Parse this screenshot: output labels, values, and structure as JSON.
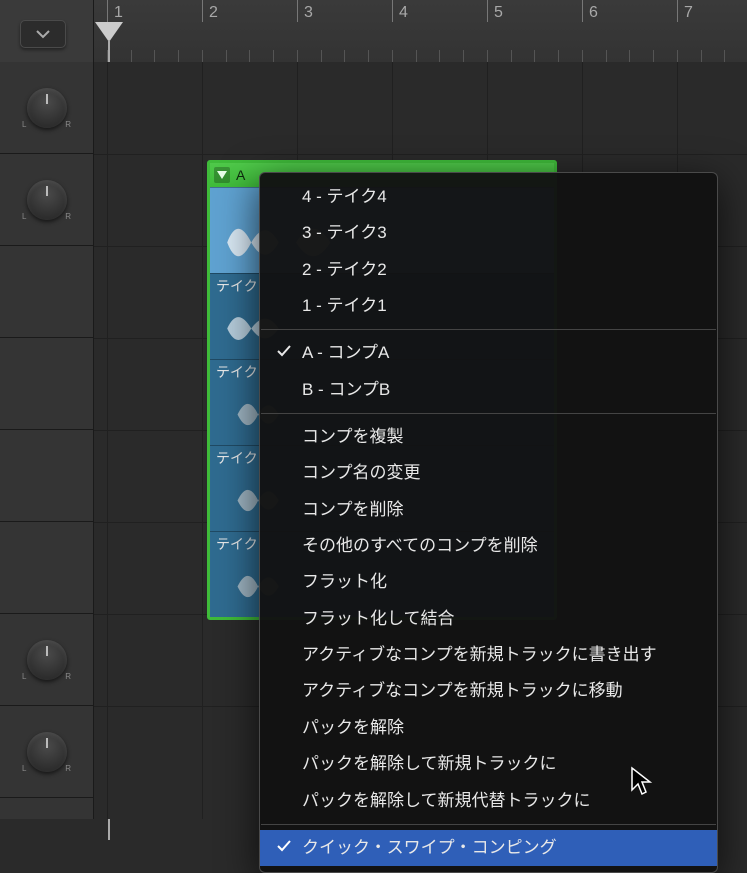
{
  "ruler": {
    "labels": [
      "1",
      "2",
      "3",
      "4",
      "5",
      "6",
      "7"
    ]
  },
  "lr": {
    "l": "L",
    "r": "R"
  },
  "take_folder": {
    "header_label": "A",
    "lanes": [
      {
        "label": "",
        "selected": true
      },
      {
        "label": "テイク"
      },
      {
        "label": "テイク"
      },
      {
        "label": "テイク"
      },
      {
        "label": "テイク"
      }
    ]
  },
  "menu": {
    "takes": [
      {
        "label": "4 - テイク4"
      },
      {
        "label": "3 - テイク3"
      },
      {
        "label": "2 - テイク2"
      },
      {
        "label": "1 - テイク1"
      }
    ],
    "comps": [
      {
        "label": "A - コンプA",
        "checked": true
      },
      {
        "label": "B - コンプB",
        "checked": false
      }
    ],
    "actions": [
      "コンプを複製",
      "コンプ名の変更",
      "コンプを削除",
      "その他のすべてのコンプを削除",
      "フラット化",
      "フラット化して結合",
      "アクティブなコンプを新規トラックに書き出す",
      "アクティブなコンプを新規トラックに移動",
      "パックを解除",
      "パックを解除して新規トラックに",
      "パックを解除して新規代替トラックに"
    ],
    "footer": {
      "label": "クイック・スワイプ・コンピング",
      "checked": true
    }
  }
}
